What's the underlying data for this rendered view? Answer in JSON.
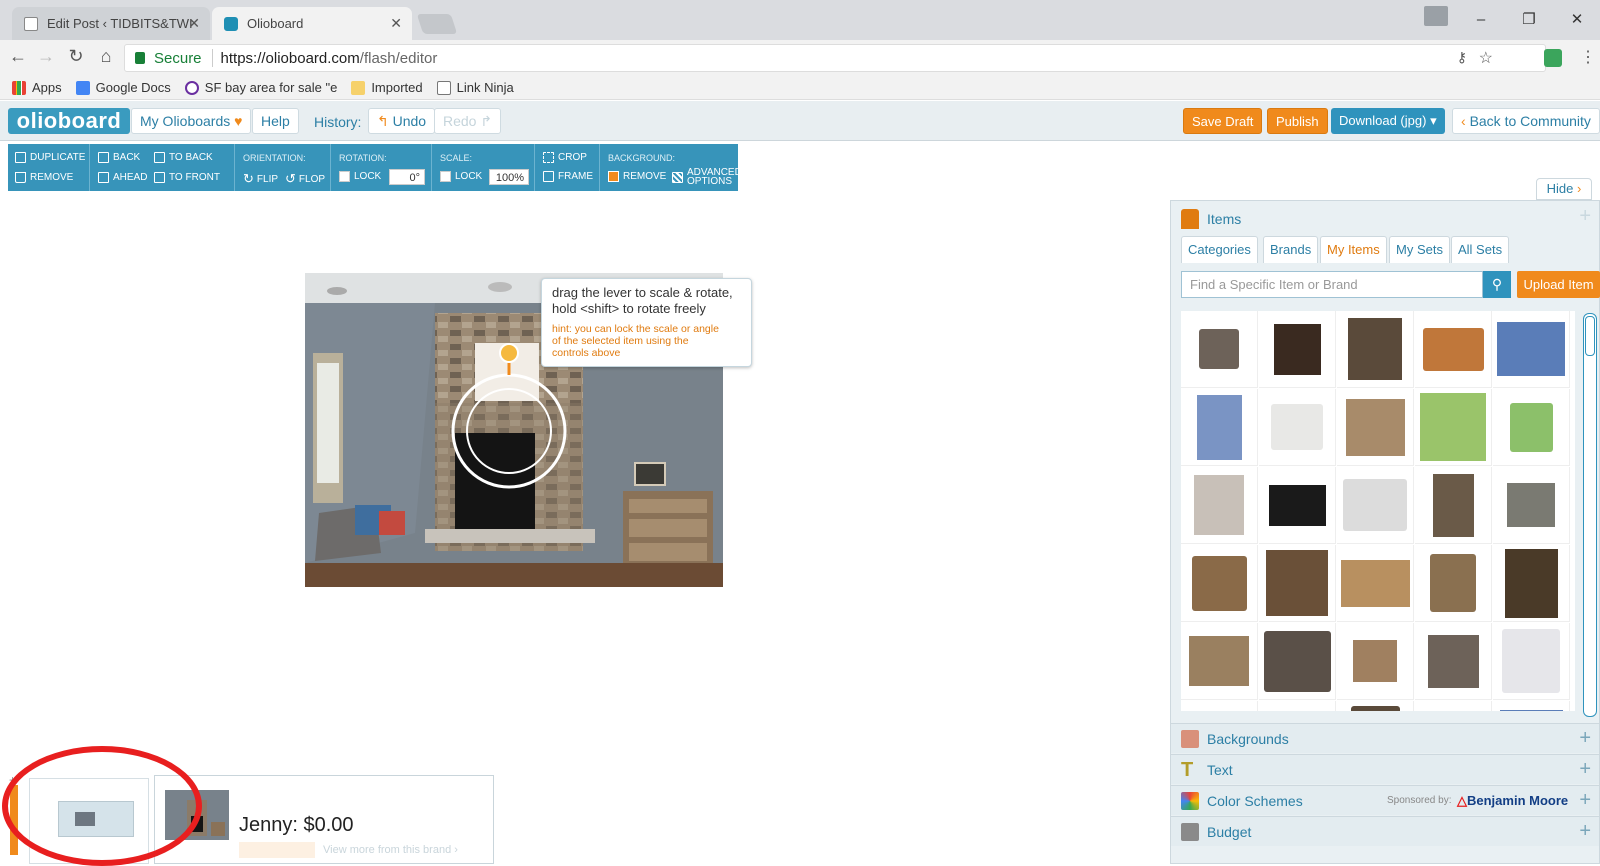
{
  "browser": {
    "tabs": [
      {
        "title": "Edit Post ‹ TIDBITS&TWI",
        "active": false
      },
      {
        "title": "Olioboard",
        "active": true
      }
    ],
    "security_label": "Secure",
    "url_host": "https://olioboard.com",
    "url_path": "/flash/editor",
    "bookmarks": [
      "Apps",
      "Google Docs",
      "SF bay area for sale \"e",
      "Imported",
      "Link Ninja"
    ]
  },
  "app": {
    "logo": "olioboard",
    "nav": {
      "my_olioboards": "My Olioboards",
      "help": "Help",
      "history_label": "History:",
      "undo": "Undo",
      "redo": "Redo"
    },
    "actions": {
      "save_draft": "Save Draft",
      "publish": "Publish",
      "download": "Download (jpg)",
      "back": "Back to Community"
    }
  },
  "toolbar": {
    "duplicate": "DUPLICATE",
    "remove": "REMOVE",
    "back": "BACK",
    "ahead": "AHEAD",
    "to_back": "TO BACK",
    "to_front": "TO FRONT",
    "orientation_label": "ORIENTATION:",
    "flip": "FLIP",
    "flop": "FLOP",
    "rotation_label": "ROTATION:",
    "rotation_lock": "LOCK",
    "rotation_value": "0°",
    "scale_label": "SCALE:",
    "scale_lock": "LOCK",
    "scale_value": "100%",
    "crop": "CROP",
    "frame": "FRAME",
    "background_label": "BACKGROUND:",
    "bg_remove": "REMOVE",
    "advanced_1": "ADVANCED",
    "advanced_2": "OPTIONS"
  },
  "tooltip": {
    "main_1": "drag the lever to scale & rotate,",
    "main_2": "hold <shift> to rotate freely",
    "hint_1": "hint: you can lock the scale or angle",
    "hint_2": "of the selected item using the",
    "hint_3": "controls above"
  },
  "sidebar": {
    "hide": "Hide",
    "items_title": "Items",
    "tabs": [
      "Categories",
      "Brands",
      "My Items",
      "My Sets",
      "All Sets"
    ],
    "active_tab": "My Items",
    "search_placeholder": "Find a Specific Item or Brand",
    "upload": "Upload Item",
    "sections": [
      {
        "label": "Backgrounds"
      },
      {
        "label": "Text"
      },
      {
        "label": "Color Schemes",
        "sponsor_label": "Sponsored by:",
        "sponsor": "Benjamin Moore"
      },
      {
        "label": "Budget"
      }
    ]
  },
  "bottom": {
    "owner_price": "Jenny: $0.00",
    "view_more": "View more from this brand ›"
  },
  "colors": {
    "accent": "#3794ba",
    "orange": "#f08a1c",
    "annotation": "#e81f1f"
  }
}
